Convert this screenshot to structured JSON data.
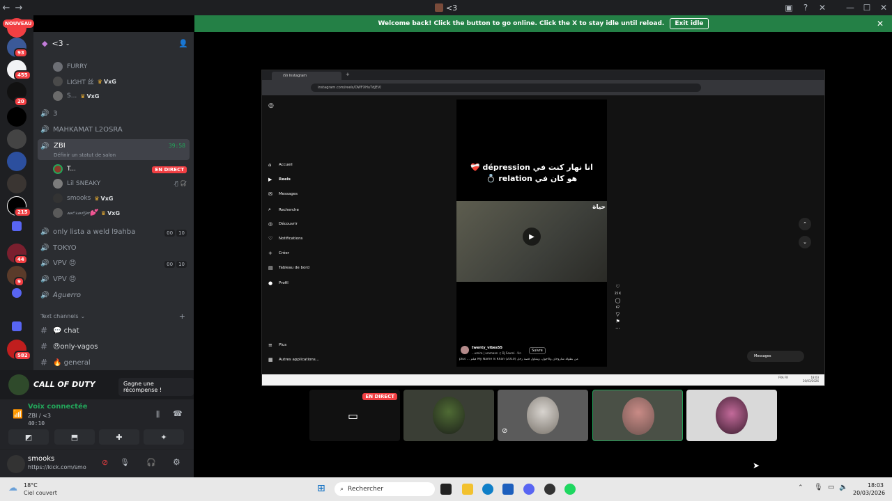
{
  "window": {
    "title": "<3"
  },
  "banner": {
    "text": "Welcome back! Click the button to go online. Click the X to stay idle until reload.",
    "exit_label": "Exit idle"
  },
  "rail": {
    "nouveau": "NOUVEAU",
    "badges": [
      "93",
      "455",
      "20",
      "215",
      "44",
      "9",
      "582"
    ]
  },
  "server": {
    "name": "<3"
  },
  "channels": {
    "users_top": [
      {
        "name": "FURRY"
      },
      {
        "name": "LIGHT 丝",
        "tag": "VxG"
      },
      {
        "name": "S...",
        "tag": "VxG"
      }
    ],
    "voice": [
      {
        "name": "3"
      },
      {
        "name": "MAHKAMAT L2OSRA"
      }
    ],
    "active": {
      "name": "ZBI",
      "timer": "39:58",
      "status": "Définir un statut de salon"
    },
    "active_users": [
      {
        "name": "T...",
        "live": "EN DIRECT"
      },
      {
        "name": "Lil SNEAKY"
      },
      {
        "name": "smooks",
        "tag": "VxG"
      },
      {
        "name": "𝓂𝑒𝓇𝓃𝒾𝑔𝒶💕",
        "tag": "VxG"
      }
    ],
    "more_voice": [
      {
        "name": "only lista a weld l9ahba",
        "c1": "00",
        "c2": "10"
      },
      {
        "name": "TOKYO"
      },
      {
        "name": "VPV 😠",
        "c1": "00",
        "c2": "10"
      },
      {
        "name": "VPV 😠"
      },
      {
        "name": "𝘈𝘨𝘶𝘦𝘳𝘳𝘰"
      }
    ],
    "text_header": "Text channels",
    "text": [
      {
        "name": "💬 chat"
      },
      {
        "name": "😠only-vagos"
      },
      {
        "name": "🔥 general"
      }
    ]
  },
  "promo": {
    "title": "CALL OF DUTY",
    "button": "Gagne une récompense !"
  },
  "voice_panel": {
    "status": "Voix connectée",
    "channel": "ZBI / <3",
    "timer": "40:10"
  },
  "user_panel": {
    "name": "smooks",
    "status": "https://kick.com/smo"
  },
  "stream": {
    "tab_title": "(9) Instagram",
    "url": "instagram.com/reels/DWFXHuTdJEV/",
    "nav": [
      "Accueil",
      "Reels",
      "Messages",
      "Recherche",
      "Découvrir",
      "Notifications",
      "Créer",
      "Tableau de bord",
      "Profil"
    ],
    "more": [
      "Plus",
      "Autres applications..."
    ],
    "caption_line1": "❤️‍🩹 dépression انا نهار كنت في",
    "caption_line2": "💍 relation هو كان في",
    "watermark": "حياة",
    "author": "twenty_vibes55",
    "audio": "...umira | uramaan ♫ Dj Soumi - Un",
    "follow": "Suivre",
    "desc": "plus ... فيلم My Name Is Khan (2010) من بطولة شاروخان وكاجول، ويتناول قصة رجل",
    "likes": "25 K",
    "comments": "67",
    "messages_label": "Messages",
    "clock": "18:03",
    "date": "20/03/2026",
    "lang": "FRA FR"
  },
  "tiles": {
    "live": "EN DIRECT"
  },
  "taskbar": {
    "weather_temp": "18°C",
    "weather_desc": "Ciel couvert",
    "search": "Rechercher",
    "time": "18:03",
    "date": "20/03/2026"
  }
}
